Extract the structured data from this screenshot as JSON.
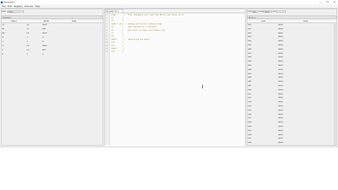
{
  "window": {
    "title": "Processor1",
    "minimize": "—",
    "maximize": "☐",
    "close": "✕"
  },
  "menu": [
    "File",
    "Edit",
    "Registry",
    "Execute",
    "Help"
  ],
  "left": {
    "state_label": "State",
    "state_value": "State",
    "registers_label": "Registers",
    "columns": [
      "Name",
      "Width",
      "Data"
    ],
    "rows": [
      [
        "A1",
        "16",
        "0000"
      ],
      [
        "B1",
        "12",
        "000"
      ],
      [
        "B9",
        "16",
        "0000"
      ],
      [
        "B",
        "1",
        "0"
      ],
      [
        "C",
        "1",
        "0"
      ],
      [
        "O",
        "16",
        "0000"
      ],
      [
        "P",
        "12",
        "000"
      ],
      [
        "Z",
        "1",
        "0"
      ]
    ]
  },
  "editor": {
    "tab_label": "Program Fol ×",
    "lines": [
      "[ADD       ]   This statement will halt the Editor and throw error",
      "[2        ]",
      "[3        ]",
      "[ADD 2 (2) ]   Adding with direct address mode",
      "[5        ]    {the operand is a multiple",
      "[6        ]    and other is taken from memory {0}",
      "[7        ]",
      "[8        ]",
      "[HALT      ]   [Executing the Halt]",
      "[10       ]",
      "[11       ]",
      "[HALT      ]",
      "[13       ]"
    ],
    "line_numbers": [
      "1",
      "2",
      "3",
      "4",
      "5",
      "6",
      "7",
      "8",
      "9",
      "10",
      "11",
      "12",
      "13"
    ]
  },
  "right": {
    "addr_label": "Addr",
    "addr_value": "000",
    "data_label": "Data",
    "data_value": "0000",
    "extra_label": "Dat",
    "memory_label": "Memory",
    "columns": [
      "Addr",
      "Data"
    ],
    "rows": [
      [
        "000",
        "0000"
      ],
      [
        "001",
        "0000"
      ],
      [
        "002",
        "0000"
      ],
      [
        "003",
        "0000"
      ],
      [
        "004",
        "0000"
      ],
      [
        "005",
        "0000"
      ],
      [
        "006",
        "0000"
      ],
      [
        "007",
        "0000"
      ],
      [
        "008",
        "0000"
      ],
      [
        "009",
        "0000"
      ],
      [
        "00A",
        "0000"
      ],
      [
        "00B",
        "0000"
      ],
      [
        "00C",
        "0000"
      ],
      [
        "00D",
        "0000"
      ],
      [
        "00E",
        "0000"
      ],
      [
        "00F",
        "0000"
      ],
      [
        "010",
        "0000"
      ],
      [
        "011",
        "0000"
      ],
      [
        "012",
        "0000"
      ],
      [
        "013",
        "0000"
      ],
      [
        "014",
        "0000"
      ],
      [
        "015",
        "0000"
      ],
      [
        "016",
        "0000"
      ],
      [
        "017",
        "0000"
      ],
      [
        "018",
        "0000"
      ],
      [
        "019",
        "0000"
      ],
      [
        "01A",
        "0000"
      ],
      [
        "01B",
        "0000"
      ],
      [
        "01C",
        "0000"
      ],
      [
        "01D",
        "0000"
      ]
    ]
  }
}
